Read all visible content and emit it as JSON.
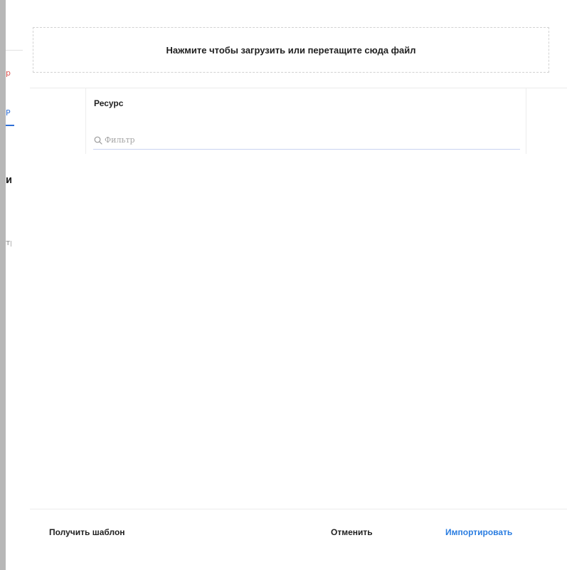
{
  "dropzone": {
    "text": "Нажмите чтобы загрузить или перетащите сюда файл"
  },
  "resource": {
    "title": "Ресурс",
    "filter_placeholder": "Фильтр",
    "filter_value": ""
  },
  "footer": {
    "get_template_label": "Получить шаблон",
    "cancel_label": "Отменить",
    "import_label": "Импортировать"
  },
  "background_fragments": {
    "frag_1": "р",
    "frag_2": "Р",
    "frag_3": "И",
    "frag_4": "тр"
  },
  "colors": {
    "accent": "#2a7de1",
    "text": "#1f1f1f",
    "border": "#d2d2d2",
    "filter_underline": "#c9d3f0"
  },
  "icons": {
    "filter": "search-icon"
  }
}
